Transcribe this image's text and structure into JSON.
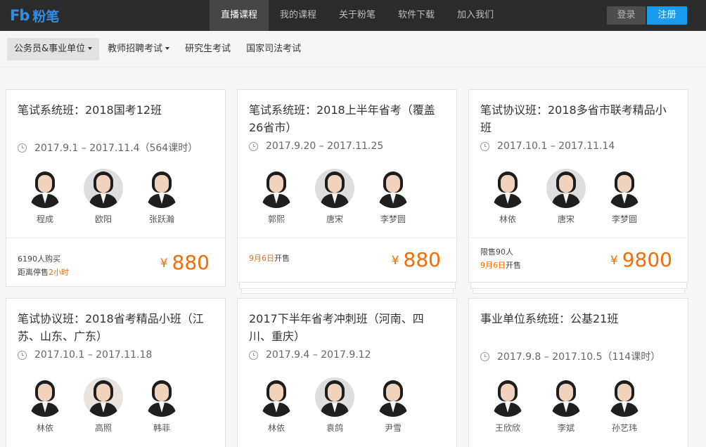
{
  "brand": {
    "mark": "Fb",
    "name": "粉笔",
    "color": "#2f8fe6"
  },
  "topnav": {
    "items": [
      {
        "label": "直播课程",
        "active": true
      },
      {
        "label": "我的课程",
        "active": false
      },
      {
        "label": "关于粉笔",
        "active": false
      },
      {
        "label": "软件下载",
        "active": false
      },
      {
        "label": "加入我们",
        "active": false
      }
    ],
    "login_label": "登录",
    "register_label": "注册"
  },
  "subnav": {
    "items": [
      {
        "label": "公务员&事业单位",
        "dropdown": true,
        "active": true
      },
      {
        "label": "教师招聘考试",
        "dropdown": true,
        "active": false
      },
      {
        "label": "研究生考试",
        "dropdown": false,
        "active": false
      },
      {
        "label": "国家司法考试",
        "dropdown": false,
        "active": false
      }
    ]
  },
  "courses": [
    {
      "title": "笔试系统班：2018国考12班",
      "time": "2017.9.1 – 2017.11.4（564课时）",
      "teachers": [
        {
          "name": "程成"
        },
        {
          "name": "欧阳"
        },
        {
          "name": "张跃瀚"
        }
      ],
      "foot": {
        "line1": "6190人购买",
        "line2_prefix": "距离停售",
        "line2_highlight": "2小时"
      },
      "currency": "¥",
      "price": "880"
    },
    {
      "title": "笔试系统班：2018上半年省考（覆盖26省市）",
      "time": "2017.9.20 – 2017.11.25",
      "teachers": [
        {
          "name": "郭熙"
        },
        {
          "name": "唐宋"
        },
        {
          "name": "李梦圆"
        }
      ],
      "foot": {
        "line1_highlight": "9月6日",
        "line1_suffix": "开售"
      },
      "currency": "¥",
      "price": "880"
    },
    {
      "title": "笔试协议班：2018多省市联考精品小班",
      "time": "2017.10.1 – 2017.11.14",
      "teachers": [
        {
          "name": "林依"
        },
        {
          "name": "唐宋"
        },
        {
          "name": "李梦圆"
        }
      ],
      "foot": {
        "line1": "限售90人",
        "line2_highlight": "9月6日",
        "line2_suffix": "开售"
      },
      "currency": "¥",
      "price": "9800"
    },
    {
      "title": "笔试协议班：2018省考精品小班（江苏、山东、广东）",
      "time": "2017.10.1 – 2017.11.18",
      "teachers": [
        {
          "name": "林依"
        },
        {
          "name": "高照"
        },
        {
          "name": "韩菲"
        }
      ]
    },
    {
      "title": "2017下半年省考冲刺班（河南、四川、重庆）",
      "time": "2017.9.4 – 2017.9.12",
      "teachers": [
        {
          "name": "林依"
        },
        {
          "name": "袁鸽"
        },
        {
          "name": "尹雪"
        }
      ]
    },
    {
      "title": "事业单位系统班：公基21班",
      "time": "2017.9.8 – 2017.10.5（114课时）",
      "teachers": [
        {
          "name": "王欣欣"
        },
        {
          "name": "李斌"
        },
        {
          "name": "孙艺玮"
        }
      ]
    }
  ],
  "colors": {
    "accent": "#199bf0",
    "price": "#fa6a00",
    "topbar": "#2b2b2b"
  }
}
